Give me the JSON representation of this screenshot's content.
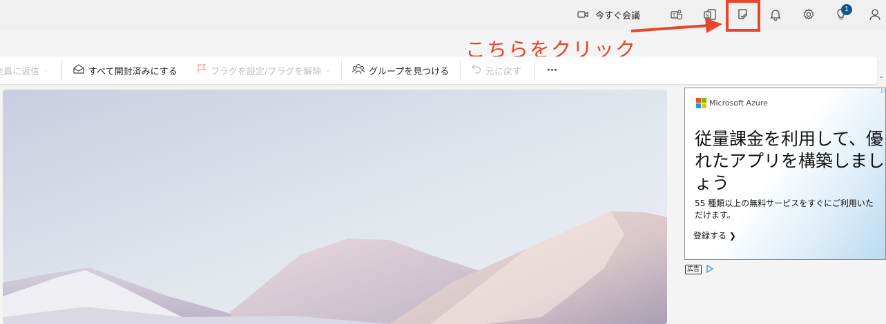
{
  "header": {
    "meet_now_label": "今すぐ会議",
    "notification_badge": "1"
  },
  "annotation": {
    "text": "こちらをクリック",
    "color": "#e8452a"
  },
  "commands": {
    "reply_all": "全員に返信",
    "mark_all_read": "すべて開封済みにする",
    "flag": "フラグを設定/フラグを解除",
    "discover_groups": "グループを見つける",
    "undo": "元に戻す",
    "more": "···"
  },
  "ad": {
    "brand": "Microsoft Azure",
    "headline": "従量課金を利用して、優れたアプリを構築しましょう",
    "subtext": "55 種類以上の無料サービスをすぐにご利用いただけます。",
    "cta": "登録する ❯",
    "label": "広告",
    "brand_colors": [
      "#f25022",
      "#7fba00",
      "#00a4ef",
      "#ffb900"
    ]
  }
}
